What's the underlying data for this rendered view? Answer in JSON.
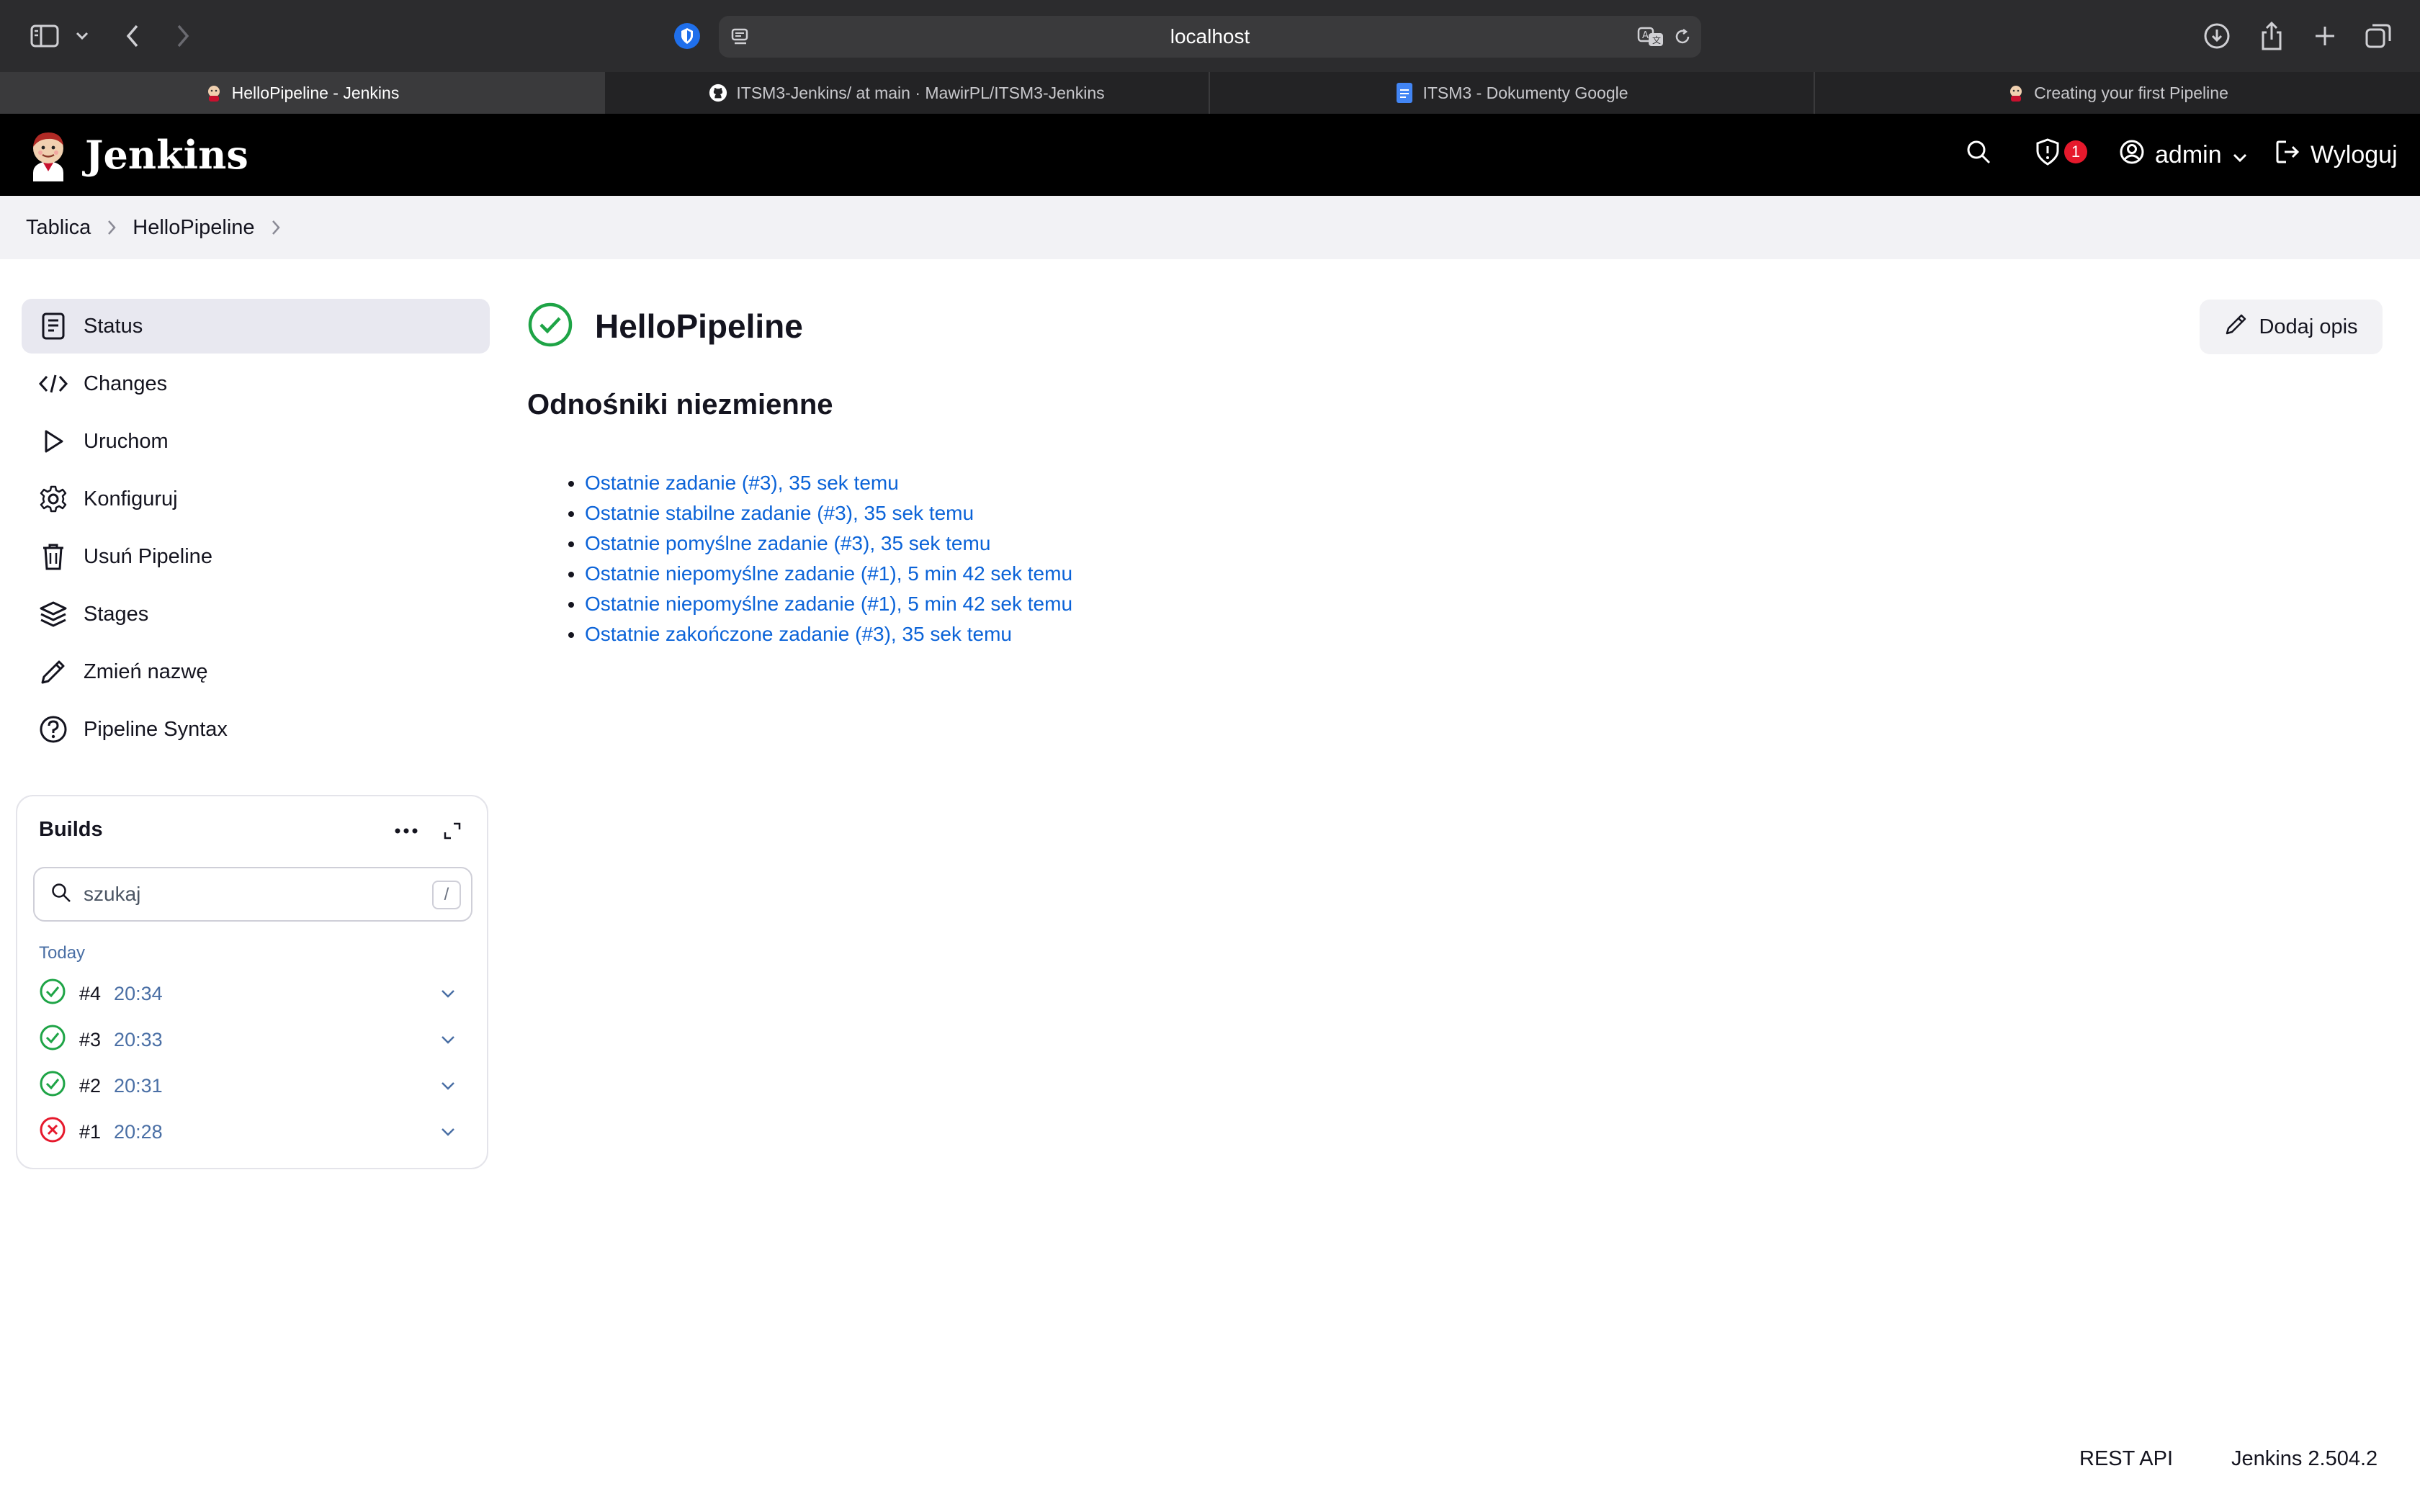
{
  "browser": {
    "url": "localhost",
    "tabs": [
      {
        "label": "HelloPipeline - Jenkins",
        "active": true
      },
      {
        "label": "ITSM3-Jenkins/ at main · MawirPL/ITSM3-Jenkins",
        "active": false
      },
      {
        "label": "ITSM3 - Dokumenty Google",
        "active": false
      },
      {
        "label": "Creating your first Pipeline",
        "active": false
      }
    ]
  },
  "header": {
    "brand": "Jenkins",
    "security_badge_count": "1",
    "user": "admin",
    "logout": "Wyloguj"
  },
  "breadcrumb": [
    "Tablica",
    "HelloPipeline"
  ],
  "sidebar": {
    "items": [
      {
        "label": "Status",
        "icon": "document-icon"
      },
      {
        "label": "Changes",
        "icon": "code-icon"
      },
      {
        "label": "Uruchom",
        "icon": "play-icon"
      },
      {
        "label": "Konfiguruj",
        "icon": "gear-icon"
      },
      {
        "label": "Usuń Pipeline",
        "icon": "trash-icon"
      },
      {
        "label": "Stages",
        "icon": "layers-icon"
      },
      {
        "label": "Zmień nazwę",
        "icon": "pencil-icon"
      },
      {
        "label": "Pipeline Syntax",
        "icon": "help-icon"
      }
    ]
  },
  "builds": {
    "title": "Builds",
    "search_placeholder": "szukaj",
    "search_shortcut": "/",
    "group": "Today",
    "rows": [
      {
        "num": "#4",
        "time": "20:34",
        "status": "success"
      },
      {
        "num": "#3",
        "time": "20:33",
        "status": "success"
      },
      {
        "num": "#2",
        "time": "20:31",
        "status": "success"
      },
      {
        "num": "#1",
        "time": "20:28",
        "status": "failure"
      }
    ]
  },
  "main": {
    "title": "HelloPipeline",
    "add_description": "Dodaj opis",
    "permalinks_title": "Odnośniki niezmienne",
    "permalinks": [
      "Ostatnie zadanie (#3), 35 sek temu",
      "Ostatnie stabilne zadanie (#3), 35 sek temu",
      "Ostatnie pomyślne zadanie (#3), 35 sek temu",
      "Ostatnie niepomyślne zadanie (#1), 5 min 42 sek temu",
      "Ostatnie niepomyślne zadanie (#1), 5 min 42 sek temu",
      "Ostatnie zakończone zadanie (#3), 35 sek temu"
    ]
  },
  "footer": {
    "rest_api": "REST API",
    "version": "Jenkins 2.504.2"
  },
  "colors": {
    "success": "#1ea446",
    "failure": "#e6192c",
    "link": "#0b63d8"
  }
}
